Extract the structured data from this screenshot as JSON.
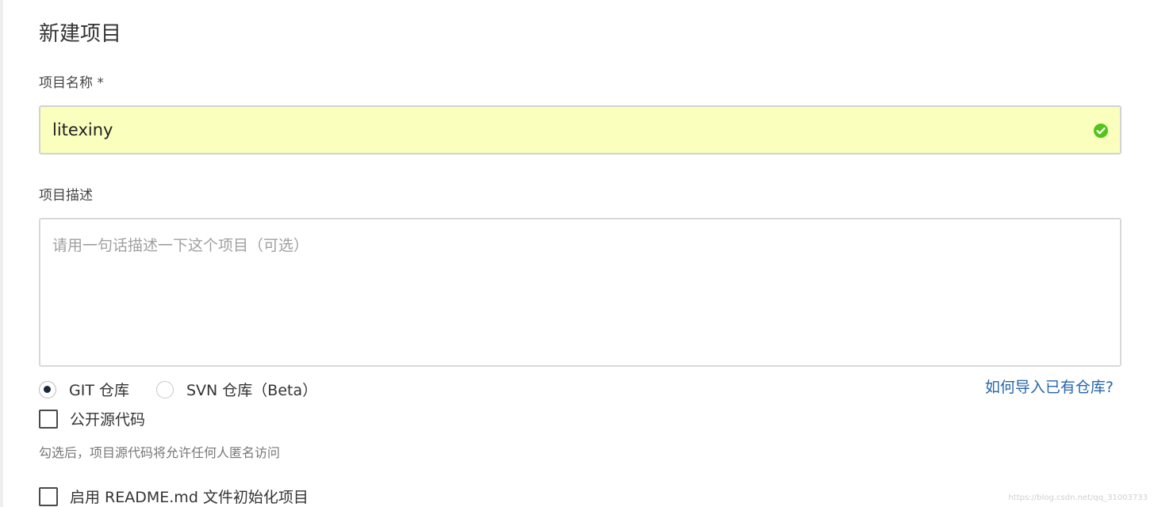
{
  "page": {
    "title": "新建项目"
  },
  "name_field": {
    "label": "项目名称 *",
    "value": "litexiny",
    "status_icon": "check-circle-icon",
    "background_color": "#faffbd",
    "status_color": "#52c41a"
  },
  "description_field": {
    "label": "项目描述",
    "value": "",
    "placeholder": "请用一句话描述一下这个项目（可选）"
  },
  "repo_type": {
    "options": [
      {
        "label": "GIT 仓库",
        "selected": true
      },
      {
        "label": "SVN 仓库（Beta）",
        "selected": false
      }
    ],
    "import_link": "如何导入已有仓库?"
  },
  "public_source": {
    "label": "公开源代码",
    "checked": false,
    "hint": "勾选后，项目源代码将允许任何人匿名访问"
  },
  "readme_init": {
    "label": "启用 README.md 文件初始化项目",
    "checked": false
  },
  "watermark": "https://blog.csdn.net/qq_31003733",
  "colors": {
    "link": "#2766a9",
    "radio_selected": "#1b2a3a"
  }
}
